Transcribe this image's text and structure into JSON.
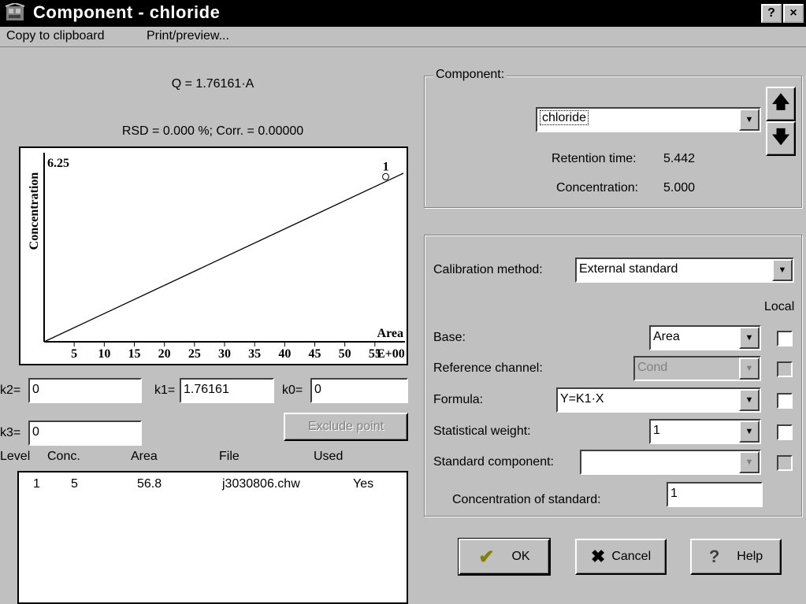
{
  "window": {
    "title": "Component - chloride",
    "help_btn": "?",
    "close_btn": "×"
  },
  "menu": {
    "copy": "Copy to clipboard",
    "print": "Print/preview..."
  },
  "left": {
    "equation": "Q = 1.76161·A",
    "stats": "RSD = 0.000 %;  Corr. = 0.00000",
    "k2_label": "k2=",
    "k2": "0",
    "k1_label": "k1=",
    "k1": "1.76161",
    "k0_label": "k0=",
    "k0": "0",
    "k3_label": "k3=",
    "k3": "0",
    "exclude_btn": "Exclude point",
    "table_headers": [
      "Level",
      "Conc.",
      "Area",
      "File",
      "Used"
    ],
    "rows": [
      {
        "level": "1",
        "conc": "5",
        "area": "56.8",
        "file": "j3030806.chw",
        "used": "Yes"
      }
    ]
  },
  "chart_data": {
    "type": "line",
    "xlabel": "Area",
    "ylabel": "Concentration",
    "y_top_label": "6.25",
    "x_ticks": [
      "5",
      "10",
      "15",
      "20",
      "25",
      "30",
      "35",
      "40",
      "45",
      "50",
      "55"
    ],
    "x_suffix": "E+00",
    "xlim": [
      0,
      60
    ],
    "ylim": [
      0,
      6.25
    ],
    "line": {
      "slope": 1.76161,
      "intercept": 0
    },
    "points": [
      {
        "label": "1",
        "x": 56.8,
        "y": 100.06
      }
    ]
  },
  "component": {
    "group_label": "Component:",
    "selected": "chloride",
    "retention_label": "Retention time:",
    "retention": "5.442",
    "concentration_label": "Concentration:",
    "concentration": "5.000",
    "up_icon": "up-arrow-icon",
    "down_icon": "down-arrow-icon"
  },
  "calibration": {
    "method_label": "Calibration method:",
    "method": "External standard",
    "local_label": "Local",
    "base_label": "Base:",
    "base": "Area",
    "ref_label": "Reference channel:",
    "ref": "Cond",
    "formula_label": "Formula:",
    "formula": "Y=K1·X",
    "weight_label": "Statistical weight:",
    "weight": "1",
    "std_comp_label": "Standard component:",
    "std_comp": "",
    "std_conc_label": "Concentration of standard:",
    "std_conc": "1"
  },
  "buttons": {
    "ok": "OK",
    "cancel": "Cancel",
    "help": "Help"
  },
  "colors": {
    "title_bg": "#000000",
    "face": "#c0c0c0",
    "disabled": "#808080",
    "cancel_x": "#000000",
    "ok_check": "#808000"
  }
}
